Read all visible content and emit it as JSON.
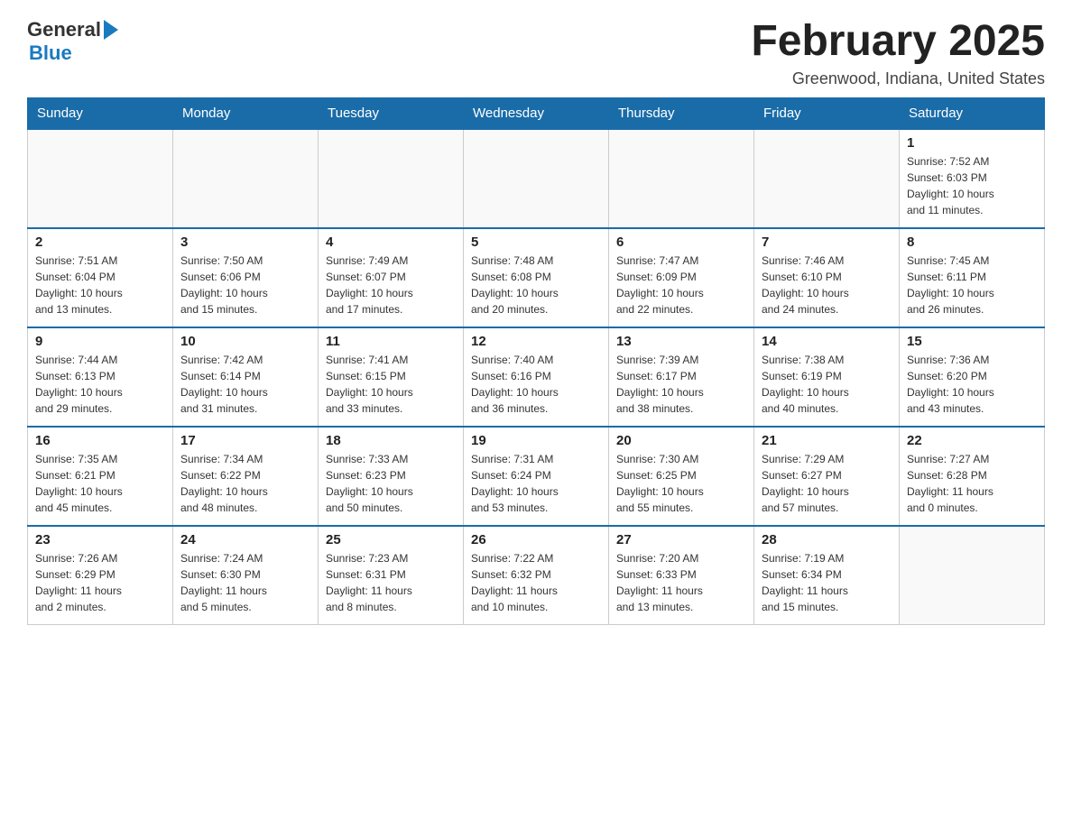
{
  "header": {
    "logo_general": "General",
    "logo_blue": "Blue",
    "month_title": "February 2025",
    "location": "Greenwood, Indiana, United States"
  },
  "days_of_week": [
    "Sunday",
    "Monday",
    "Tuesday",
    "Wednesday",
    "Thursday",
    "Friday",
    "Saturday"
  ],
  "weeks": [
    {
      "days": [
        {
          "number": "",
          "info": ""
        },
        {
          "number": "",
          "info": ""
        },
        {
          "number": "",
          "info": ""
        },
        {
          "number": "",
          "info": ""
        },
        {
          "number": "",
          "info": ""
        },
        {
          "number": "",
          "info": ""
        },
        {
          "number": "1",
          "info": "Sunrise: 7:52 AM\nSunset: 6:03 PM\nDaylight: 10 hours\nand 11 minutes."
        }
      ]
    },
    {
      "days": [
        {
          "number": "2",
          "info": "Sunrise: 7:51 AM\nSunset: 6:04 PM\nDaylight: 10 hours\nand 13 minutes."
        },
        {
          "number": "3",
          "info": "Sunrise: 7:50 AM\nSunset: 6:06 PM\nDaylight: 10 hours\nand 15 minutes."
        },
        {
          "number": "4",
          "info": "Sunrise: 7:49 AM\nSunset: 6:07 PM\nDaylight: 10 hours\nand 17 minutes."
        },
        {
          "number": "5",
          "info": "Sunrise: 7:48 AM\nSunset: 6:08 PM\nDaylight: 10 hours\nand 20 minutes."
        },
        {
          "number": "6",
          "info": "Sunrise: 7:47 AM\nSunset: 6:09 PM\nDaylight: 10 hours\nand 22 minutes."
        },
        {
          "number": "7",
          "info": "Sunrise: 7:46 AM\nSunset: 6:10 PM\nDaylight: 10 hours\nand 24 minutes."
        },
        {
          "number": "8",
          "info": "Sunrise: 7:45 AM\nSunset: 6:11 PM\nDaylight: 10 hours\nand 26 minutes."
        }
      ]
    },
    {
      "days": [
        {
          "number": "9",
          "info": "Sunrise: 7:44 AM\nSunset: 6:13 PM\nDaylight: 10 hours\nand 29 minutes."
        },
        {
          "number": "10",
          "info": "Sunrise: 7:42 AM\nSunset: 6:14 PM\nDaylight: 10 hours\nand 31 minutes."
        },
        {
          "number": "11",
          "info": "Sunrise: 7:41 AM\nSunset: 6:15 PM\nDaylight: 10 hours\nand 33 minutes."
        },
        {
          "number": "12",
          "info": "Sunrise: 7:40 AM\nSunset: 6:16 PM\nDaylight: 10 hours\nand 36 minutes."
        },
        {
          "number": "13",
          "info": "Sunrise: 7:39 AM\nSunset: 6:17 PM\nDaylight: 10 hours\nand 38 minutes."
        },
        {
          "number": "14",
          "info": "Sunrise: 7:38 AM\nSunset: 6:19 PM\nDaylight: 10 hours\nand 40 minutes."
        },
        {
          "number": "15",
          "info": "Sunrise: 7:36 AM\nSunset: 6:20 PM\nDaylight: 10 hours\nand 43 minutes."
        }
      ]
    },
    {
      "days": [
        {
          "number": "16",
          "info": "Sunrise: 7:35 AM\nSunset: 6:21 PM\nDaylight: 10 hours\nand 45 minutes."
        },
        {
          "number": "17",
          "info": "Sunrise: 7:34 AM\nSunset: 6:22 PM\nDaylight: 10 hours\nand 48 minutes."
        },
        {
          "number": "18",
          "info": "Sunrise: 7:33 AM\nSunset: 6:23 PM\nDaylight: 10 hours\nand 50 minutes."
        },
        {
          "number": "19",
          "info": "Sunrise: 7:31 AM\nSunset: 6:24 PM\nDaylight: 10 hours\nand 53 minutes."
        },
        {
          "number": "20",
          "info": "Sunrise: 7:30 AM\nSunset: 6:25 PM\nDaylight: 10 hours\nand 55 minutes."
        },
        {
          "number": "21",
          "info": "Sunrise: 7:29 AM\nSunset: 6:27 PM\nDaylight: 10 hours\nand 57 minutes."
        },
        {
          "number": "22",
          "info": "Sunrise: 7:27 AM\nSunset: 6:28 PM\nDaylight: 11 hours\nand 0 minutes."
        }
      ]
    },
    {
      "days": [
        {
          "number": "23",
          "info": "Sunrise: 7:26 AM\nSunset: 6:29 PM\nDaylight: 11 hours\nand 2 minutes."
        },
        {
          "number": "24",
          "info": "Sunrise: 7:24 AM\nSunset: 6:30 PM\nDaylight: 11 hours\nand 5 minutes."
        },
        {
          "number": "25",
          "info": "Sunrise: 7:23 AM\nSunset: 6:31 PM\nDaylight: 11 hours\nand 8 minutes."
        },
        {
          "number": "26",
          "info": "Sunrise: 7:22 AM\nSunset: 6:32 PM\nDaylight: 11 hours\nand 10 minutes."
        },
        {
          "number": "27",
          "info": "Sunrise: 7:20 AM\nSunset: 6:33 PM\nDaylight: 11 hours\nand 13 minutes."
        },
        {
          "number": "28",
          "info": "Sunrise: 7:19 AM\nSunset: 6:34 PM\nDaylight: 11 hours\nand 15 minutes."
        },
        {
          "number": "",
          "info": ""
        }
      ]
    }
  ]
}
